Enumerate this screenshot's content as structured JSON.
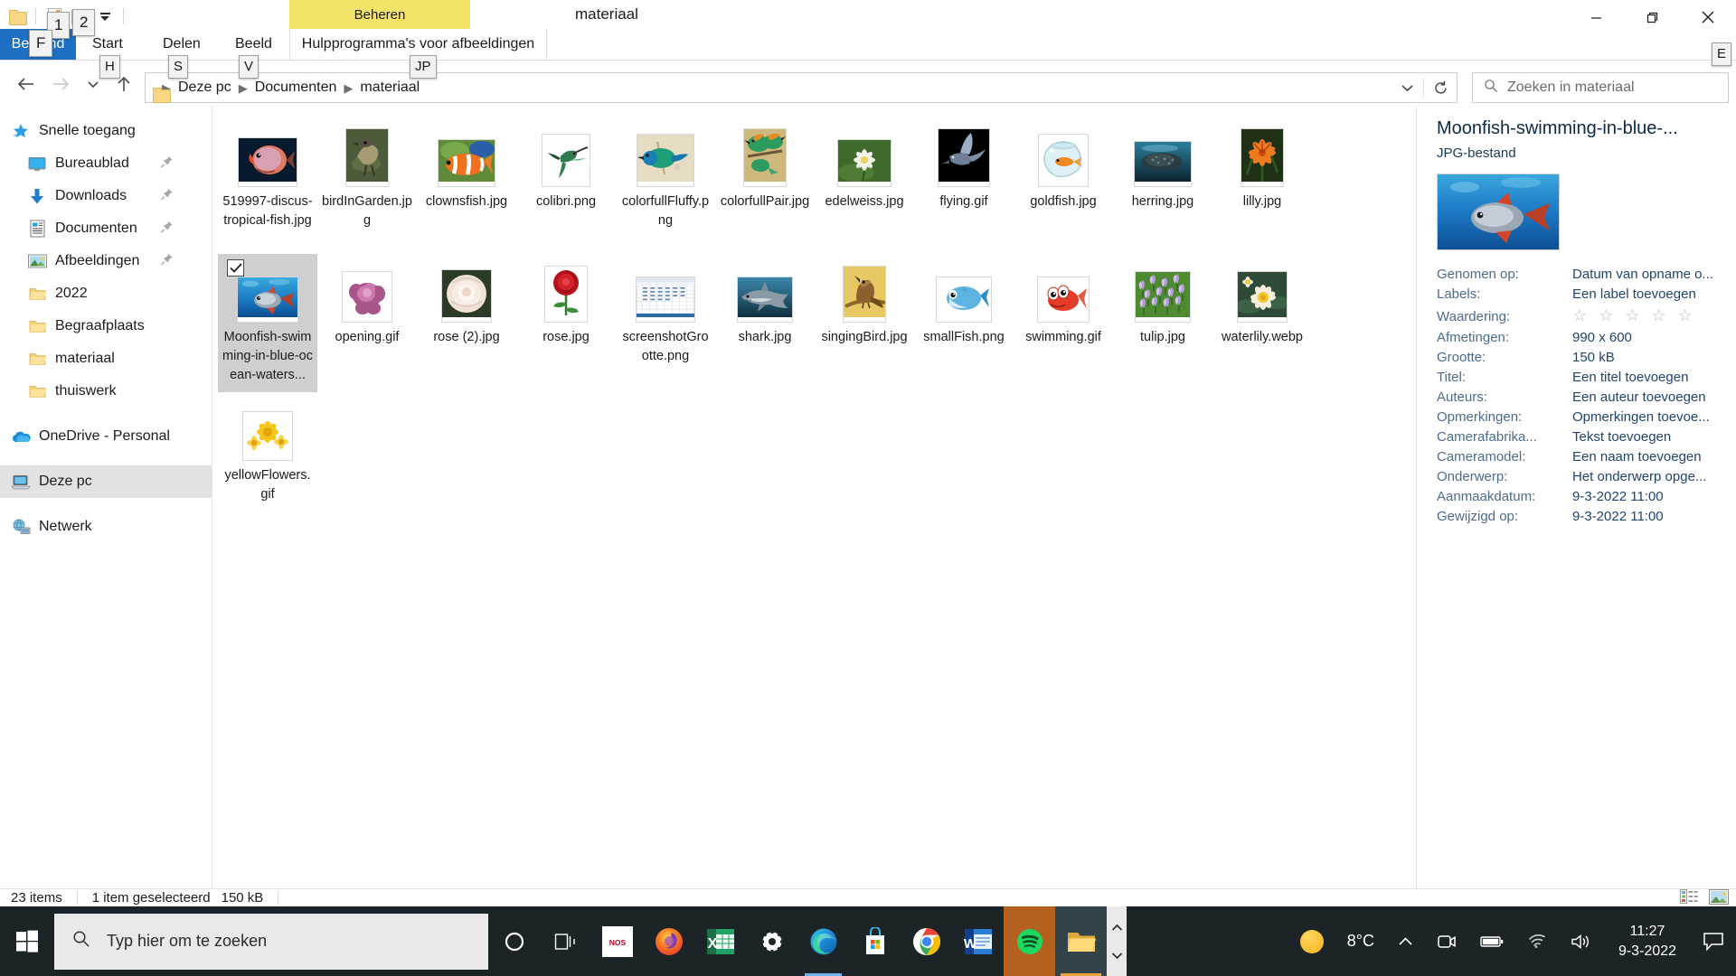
{
  "window": {
    "title": "materiaal",
    "contextual_tab_band": "Beheren",
    "contextual_tab_label": "Hulpprogramma's voor afbeeldingen",
    "quick_access": {
      "folder_icon": "folder-icon",
      "properties_icon": "properties-icon",
      "new_folder_icon": "new-folder-icon",
      "customize_icon": "customize-quick-access-icon"
    },
    "controls": {
      "minimize": "minimize-icon",
      "maximize": "restore-icon",
      "close": "close-icon"
    }
  },
  "ribbon": {
    "tabs": [
      {
        "label": "Bestand",
        "keytip": "F"
      },
      {
        "label": "Start",
        "keytip": "H"
      },
      {
        "label": "Delen",
        "keytip": "S"
      },
      {
        "label": "Beeld",
        "keytip": "V"
      }
    ],
    "contextual_tab": {
      "label": "Hulpprogramma's voor afbeeldingen",
      "keytip": "JP"
    },
    "collapse_ribbon_keytip": "E",
    "qat_keytips": [
      "1",
      "2"
    ]
  },
  "address": {
    "back_icon": "back-arrow-icon",
    "forward_icon": "forward-arrow-icon",
    "recent_icon": "recent-locations-icon",
    "up_icon": "up-arrow-icon",
    "breadcrumbs": [
      "Deze pc",
      "Documenten",
      "materiaal"
    ],
    "dropdown_icon": "chevron-down-icon",
    "refresh_icon": "refresh-icon"
  },
  "search": {
    "placeholder": "Zoeken in materiaal",
    "icon": "search-icon"
  },
  "sidebar": {
    "items": [
      {
        "label": "Snelle toegang",
        "icon": "star-icon",
        "indent": 0,
        "pinned": false,
        "selected": false
      },
      {
        "label": "Bureaublad",
        "icon": "desktop-icon",
        "indent": 1,
        "pinned": true,
        "selected": false
      },
      {
        "label": "Downloads",
        "icon": "download-icon",
        "indent": 1,
        "pinned": true,
        "selected": false
      },
      {
        "label": "Documenten",
        "icon": "document-icon",
        "indent": 1,
        "pinned": true,
        "selected": false
      },
      {
        "label": "Afbeeldingen",
        "icon": "pictures-icon",
        "indent": 1,
        "pinned": true,
        "selected": false
      },
      {
        "label": "2022",
        "icon": "folder-icon",
        "indent": 1,
        "pinned": false,
        "selected": false
      },
      {
        "label": "Begraafplaats",
        "icon": "folder-icon",
        "indent": 1,
        "pinned": false,
        "selected": false
      },
      {
        "label": "materiaal",
        "icon": "folder-icon",
        "indent": 1,
        "pinned": false,
        "selected": false
      },
      {
        "label": "thuiswerk",
        "icon": "folder-icon",
        "indent": 1,
        "pinned": false,
        "selected": false
      },
      {
        "label": "OneDrive - Personal",
        "icon": "onedrive-icon",
        "indent": 0,
        "pinned": false,
        "selected": false
      },
      {
        "label": "Deze pc",
        "icon": "this-pc-icon",
        "indent": 0,
        "pinned": false,
        "selected": true
      },
      {
        "label": "Netwerk",
        "icon": "network-icon",
        "indent": 0,
        "pinned": false,
        "selected": false
      }
    ]
  },
  "files": [
    {
      "name": "519997-discus-tropical-fish.jpg",
      "kind": "discus-fish",
      "selected": false
    },
    {
      "name": "birdInGarden.jpg",
      "kind": "bird-garden",
      "selected": false
    },
    {
      "name": "clownsfish.jpg",
      "kind": "clownfish",
      "selected": false
    },
    {
      "name": "colibri.png",
      "kind": "hummingbird",
      "selected": false
    },
    {
      "name": "colorfullFluffy.png",
      "kind": "colorful-bird",
      "selected": false
    },
    {
      "name": "colorfullPair.jpg",
      "kind": "bee-eater-pair",
      "selected": false
    },
    {
      "name": "edelweiss.jpg",
      "kind": "edelweiss-flower",
      "selected": false
    },
    {
      "name": "flying.gif",
      "kind": "flying-bird-dark",
      "selected": false
    },
    {
      "name": "goldfish.jpg",
      "kind": "goldfish-bowl",
      "selected": false
    },
    {
      "name": "herring.jpg",
      "kind": "herring-school",
      "selected": false
    },
    {
      "name": "lilly.jpg",
      "kind": "orange-lily",
      "selected": false
    },
    {
      "name": "Moonfish-swimming-in-blue-ocean-waters...",
      "kind": "moonfish",
      "selected": true
    },
    {
      "name": "opening.gif",
      "kind": "pink-rose-opening",
      "selected": false
    },
    {
      "name": "rose (2).jpg",
      "kind": "white-rose",
      "selected": false
    },
    {
      "name": "rose.jpg",
      "kind": "red-rose",
      "selected": false
    },
    {
      "name": "screenshotGrootte.png",
      "kind": "spreadsheet-screenshot",
      "selected": false
    },
    {
      "name": "shark.jpg",
      "kind": "shark",
      "selected": false
    },
    {
      "name": "singingBird.jpg",
      "kind": "singing-wren",
      "selected": false
    },
    {
      "name": "smallFish.png",
      "kind": "small-blue-fish",
      "selected": false
    },
    {
      "name": "swimming.gif",
      "kind": "red-cartoon-fish",
      "selected": false
    },
    {
      "name": "tulip.jpg",
      "kind": "purple-tulips",
      "selected": false
    },
    {
      "name": "waterlily.webp",
      "kind": "waterlily",
      "selected": false
    },
    {
      "name": "yellowFlowers.gif",
      "kind": "yellow-flowers",
      "selected": false
    }
  ],
  "details": {
    "title": "Moonfish-swimming-in-blue-...",
    "filetype": "JPG-bestand",
    "properties": [
      {
        "key": "Genomen op:",
        "value": "Datum van opname o...",
        "type": "text"
      },
      {
        "key": "Labels:",
        "value": "Een label toevoegen",
        "type": "text"
      },
      {
        "key": "Waardering:",
        "value": "☆ ☆ ☆ ☆ ☆",
        "type": "stars"
      },
      {
        "key": "Afmetingen:",
        "value": "990 x 600",
        "type": "text"
      },
      {
        "key": "Grootte:",
        "value": "150 kB",
        "type": "text"
      },
      {
        "key": "Titel:",
        "value": "Een titel toevoegen",
        "type": "text"
      },
      {
        "key": "Auteurs:",
        "value": "Een auteur toevoegen",
        "type": "text"
      },
      {
        "key": "Opmerkingen:",
        "value": "Opmerkingen toevoe...",
        "type": "text"
      },
      {
        "key": "Camerafabrika...",
        "value": "Tekst toevoegen",
        "type": "text"
      },
      {
        "key": "Cameramodel:",
        "value": "Een naam toevoegen",
        "type": "text"
      },
      {
        "key": "Onderwerp:",
        "value": "Het onderwerp opge...",
        "type": "text"
      },
      {
        "key": "Aanmaakdatum:",
        "value": "9-3-2022 11:00",
        "type": "text"
      },
      {
        "key": "Gewijzigd op:",
        "value": "9-3-2022 11:00",
        "type": "text"
      }
    ]
  },
  "statusbar": {
    "item_count": "23 items",
    "selection": "1 item geselecteerd",
    "selection_size": "150 kB",
    "details_view_icon": "details-view-icon",
    "thumbnail_view_icon": "large-icons-view-icon"
  },
  "taskbar": {
    "start_icon": "windows-start-icon",
    "search_placeholder": "Typ hier om te zoeken",
    "search_icon": "search-icon",
    "cortana_icon": "cortana-icon",
    "taskview_icon": "task-view-icon",
    "apps": [
      {
        "name": "NOS",
        "icon": "nos-icon"
      },
      {
        "name": "Firefox",
        "icon": "firefox-icon"
      },
      {
        "name": "Excel",
        "icon": "excel-icon"
      },
      {
        "name": "Instellingen",
        "icon": "settings-gear-icon"
      },
      {
        "name": "Microsoft Edge",
        "icon": "edge-icon"
      },
      {
        "name": "Microsoft Store",
        "icon": "store-icon"
      },
      {
        "name": "Google Chrome",
        "icon": "chrome-icon"
      },
      {
        "name": "Word",
        "icon": "word-icon"
      },
      {
        "name": "Spotify",
        "icon": "spotify-icon"
      },
      {
        "name": "Verkenner",
        "icon": "file-explorer-icon"
      }
    ],
    "tray": {
      "weather_temp": "8°C",
      "weather_icon": "sun-icon",
      "show_hidden_icon": "chevron-up-icon",
      "meet_now_icon": "meet-now-icon",
      "battery_icon": "battery-icon",
      "network_icon": "wifi-icon",
      "volume_icon": "speaker-icon",
      "time": "11:27",
      "date": "9-3-2022",
      "action_center_icon": "notifications-icon"
    }
  },
  "colors": {
    "accent": "#1f6fc4",
    "contextual_tab": "#f4e36a",
    "taskbar": "#1c2427",
    "selection": "#cfcfcf",
    "details_text": "#21456b"
  }
}
